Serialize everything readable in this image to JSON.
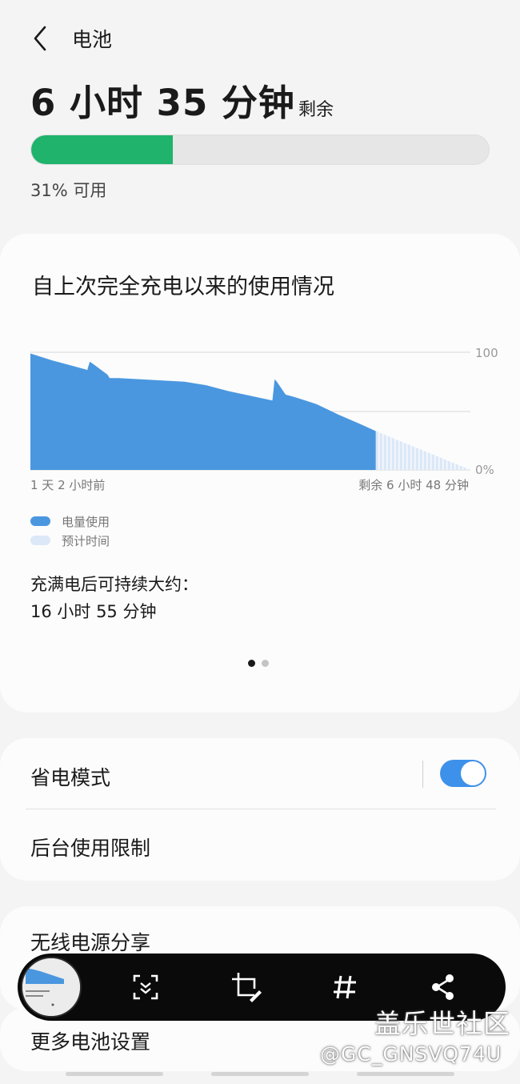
{
  "header": {
    "title": "电池"
  },
  "remaining": {
    "time": "6 小时 35 分钟",
    "suffix": "剩余"
  },
  "battery": {
    "level_fraction": 0.31,
    "available_text": "31% 可用",
    "fill_color": "#1fb36c"
  },
  "usage": {
    "title": "自上次完全充电以来的使用情况",
    "full_charge_label": "充满电后可持续大约：",
    "full_charge_value": "16 小时 55 分钟",
    "legend": [
      {
        "label": "电量使用",
        "color": "#4a97e0"
      },
      {
        "label": "预计时间",
        "color": "#dce8f7"
      }
    ],
    "pager": {
      "count": 2,
      "active": 0
    }
  },
  "chart_data": {
    "type": "area",
    "y_tick_labels": [
      "100",
      "0%"
    ],
    "ylim": [
      0,
      100
    ],
    "x_start_label": "1 天 2 小时前",
    "x_end_label": "剩余 6 小时 48 分钟",
    "grid": true,
    "series": [
      {
        "name": "电量使用",
        "color": "#4a97e0",
        "x": [
          0,
          0.05,
          0.1,
          0.13,
          0.13,
          0.135,
          0.15,
          0.175,
          0.18,
          0.2,
          0.25,
          0.3,
          0.35,
          0.4,
          0.45,
          0.5,
          0.55,
          0.555,
          0.56,
          0.58,
          0.6,
          0.65,
          0.7,
          0.75,
          0.785
        ],
        "values": [
          99,
          93,
          88,
          85,
          86,
          92,
          88,
          81,
          78,
          78,
          77,
          76,
          75,
          72,
          67,
          63,
          59,
          77,
          75,
          64,
          62,
          56,
          47,
          39,
          33
        ]
      },
      {
        "name": "预计时间",
        "color": "#dce8f7",
        "x": [
          0.785,
          1.0
        ],
        "values": [
          33,
          0
        ]
      }
    ]
  },
  "settings": [
    {
      "label": "省电模式",
      "toggle": true,
      "toggle_color": "#3e91ea"
    },
    {
      "label": "后台使用限制"
    }
  ],
  "more_rows": [
    {
      "label": "无线电源分享"
    },
    {
      "label": "更多电池设置"
    }
  ],
  "toolbar": {
    "buttons": [
      "scroll-capture-icon",
      "crop-edit-icon",
      "hashtag-icon",
      "share-icon"
    ]
  },
  "watermark": {
    "brand": "盖乐世社区",
    "user": "@GC_GNSVQ74U"
  }
}
